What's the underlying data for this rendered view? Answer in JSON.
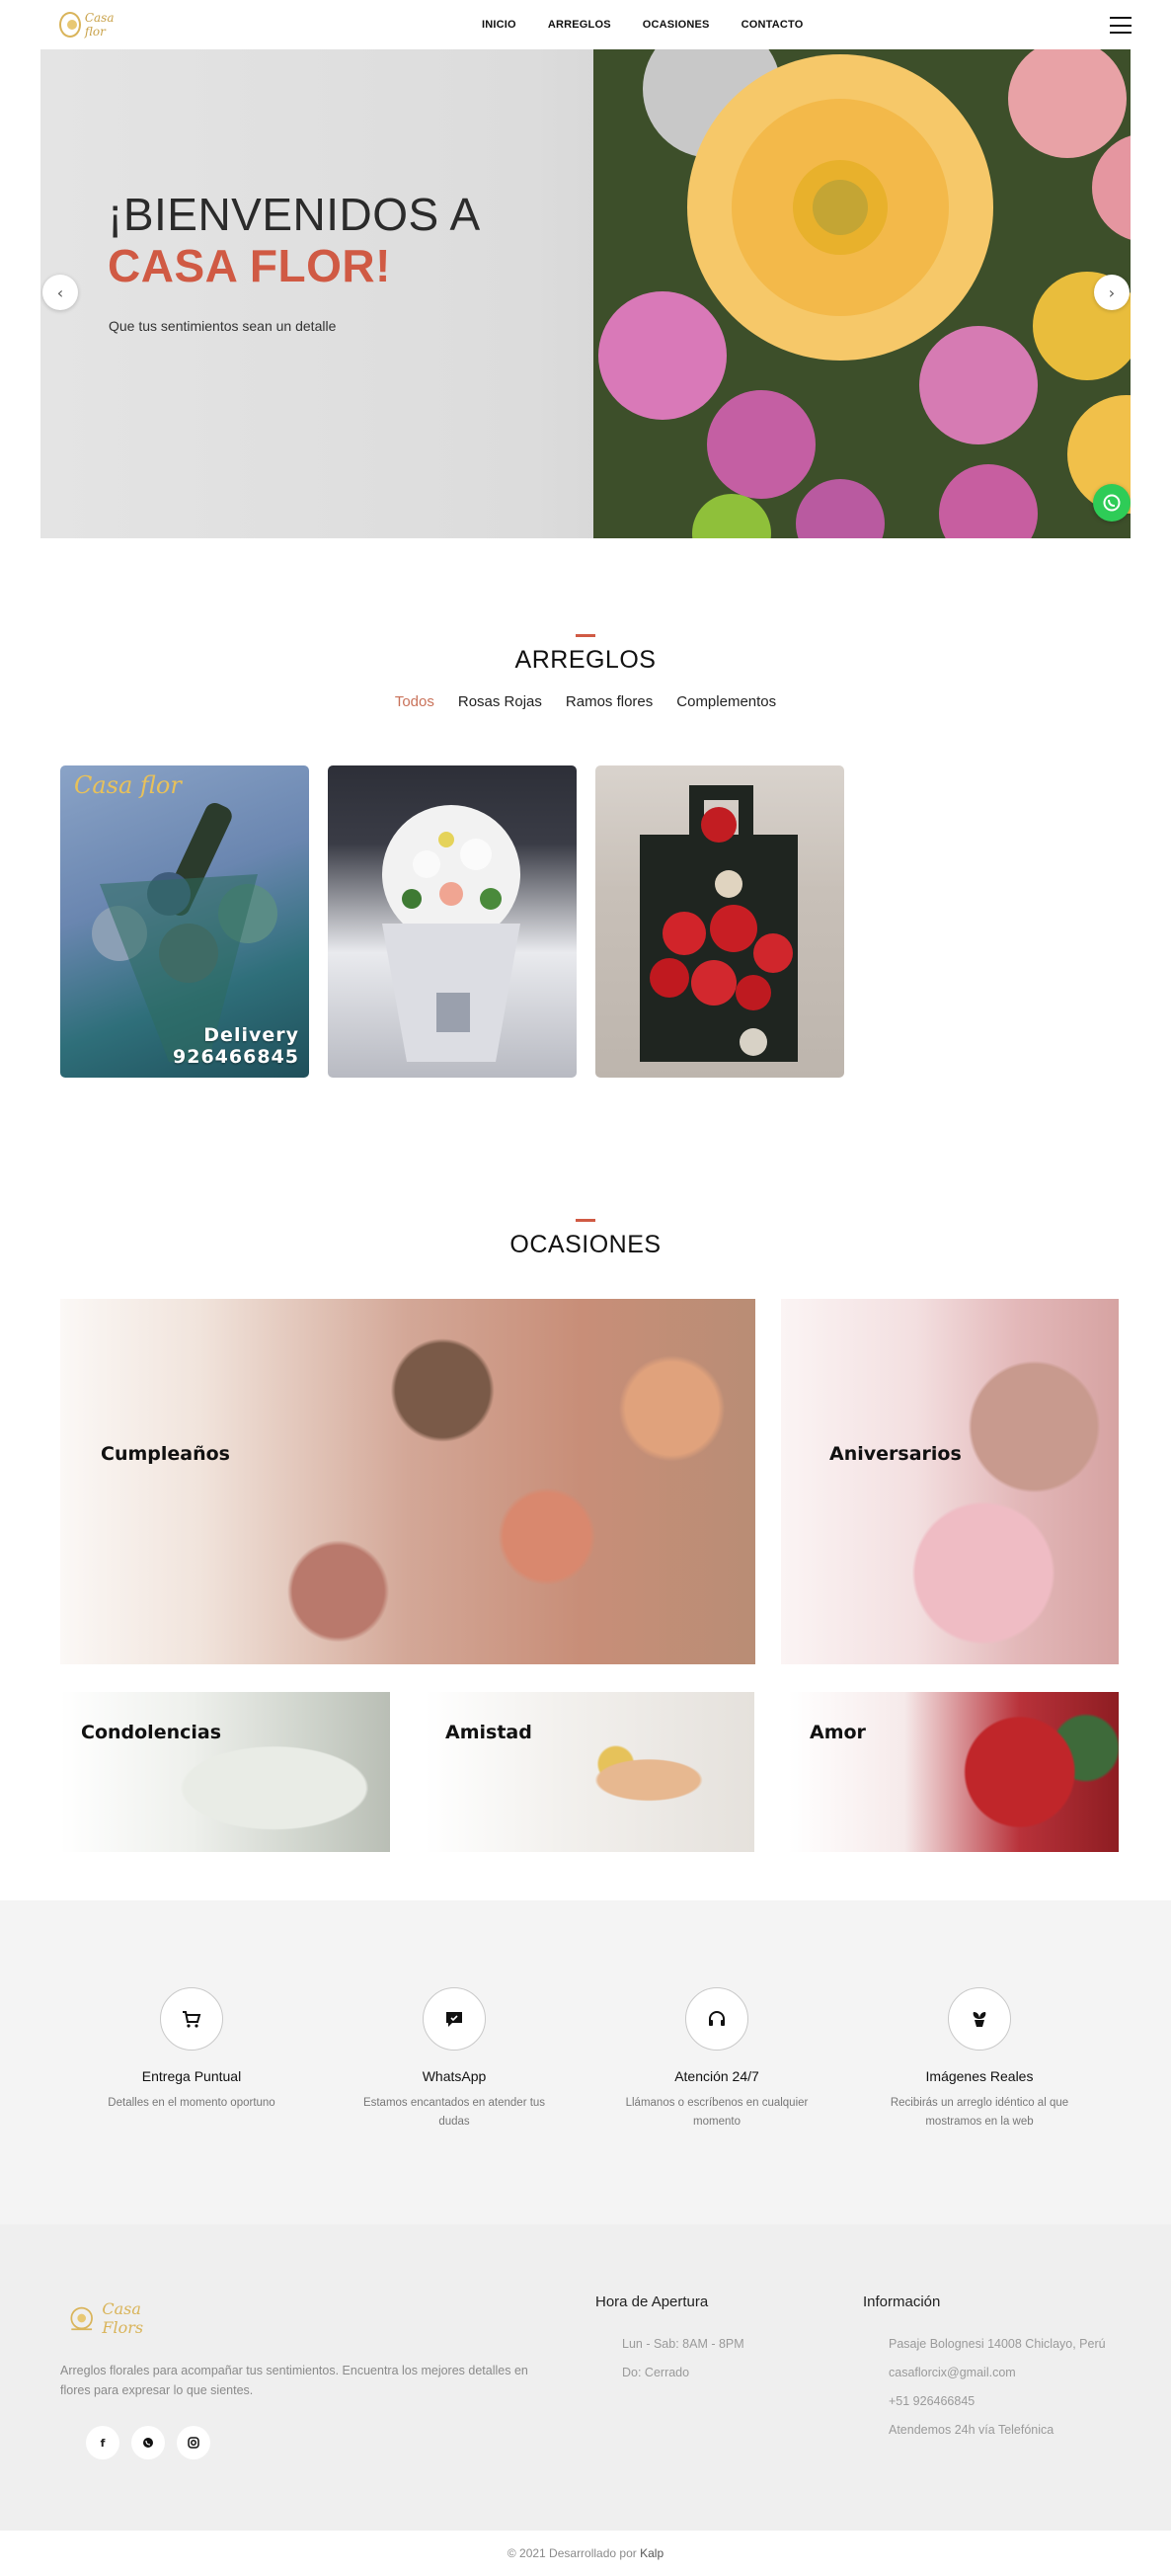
{
  "header": {
    "logo_text": "Casa flor",
    "nav": [
      "INICIO",
      "ARREGLOS",
      "OCASIONES",
      "CONTACTO"
    ]
  },
  "hero": {
    "title_line1": "¡BIENVENIDOS A",
    "title_line2": "CASA FLOR!",
    "subtitle": "Que tus sentimientos sean un detalle",
    "prev": "‹",
    "next": "›"
  },
  "arreglos": {
    "title": "ARREGLOS",
    "filters": [
      "Todos",
      "Rosas Rojas",
      "Ramos flores",
      "Complementos"
    ],
    "active_filter": "Todos",
    "card1_watermark": "Casa flor",
    "card1_text1": "Delivery",
    "card1_text2": "926466845"
  },
  "ocasiones": {
    "title": "OCASIONES",
    "items": [
      "Cumpleaños",
      "Aniversarios",
      "Condolencias",
      "Amistad",
      "Amor"
    ]
  },
  "features": [
    {
      "icon": "cart-icon",
      "title": "Entrega Puntual",
      "text": "Detalles en el momento oportuno"
    },
    {
      "icon": "chat-icon",
      "title": "WhatsApp",
      "text": "Estamos encantados en atender tus dudas"
    },
    {
      "icon": "headphones-icon",
      "title": "Atención 24/7",
      "text": "Llámanos o escríbenos en cualquier momento"
    },
    {
      "icon": "plant-icon",
      "title": "Imágenes Reales",
      "text": "Recibirás un arreglo idéntico al que mostramos en la web"
    }
  ],
  "footer": {
    "logo_text": "Casa Flors",
    "description": "Arreglos florales para acompañar tus sentimientos. Encuentra los mejores detalles en flores para expresar lo que sientes.",
    "social": [
      "f",
      "w",
      "ig"
    ],
    "hours_title": "Hora de Apertura",
    "hours": [
      "Lun - Sab: 8AM - 8PM",
      "Do: Cerrado"
    ],
    "info_title": "Información",
    "info": [
      "Pasaje Bolognesi 14008 Chiclayo, Perú",
      "casaflorcix@gmail.com",
      "+51 926466845",
      "Atendemos 24h vía Telefónica"
    ]
  },
  "copyright": {
    "text": "© 2021 Desarrollado por",
    "author": "Kalp"
  },
  "colors": {
    "accent": "#d05a44",
    "whatsapp": "#2ecc57",
    "gold": "#c9a24a"
  }
}
